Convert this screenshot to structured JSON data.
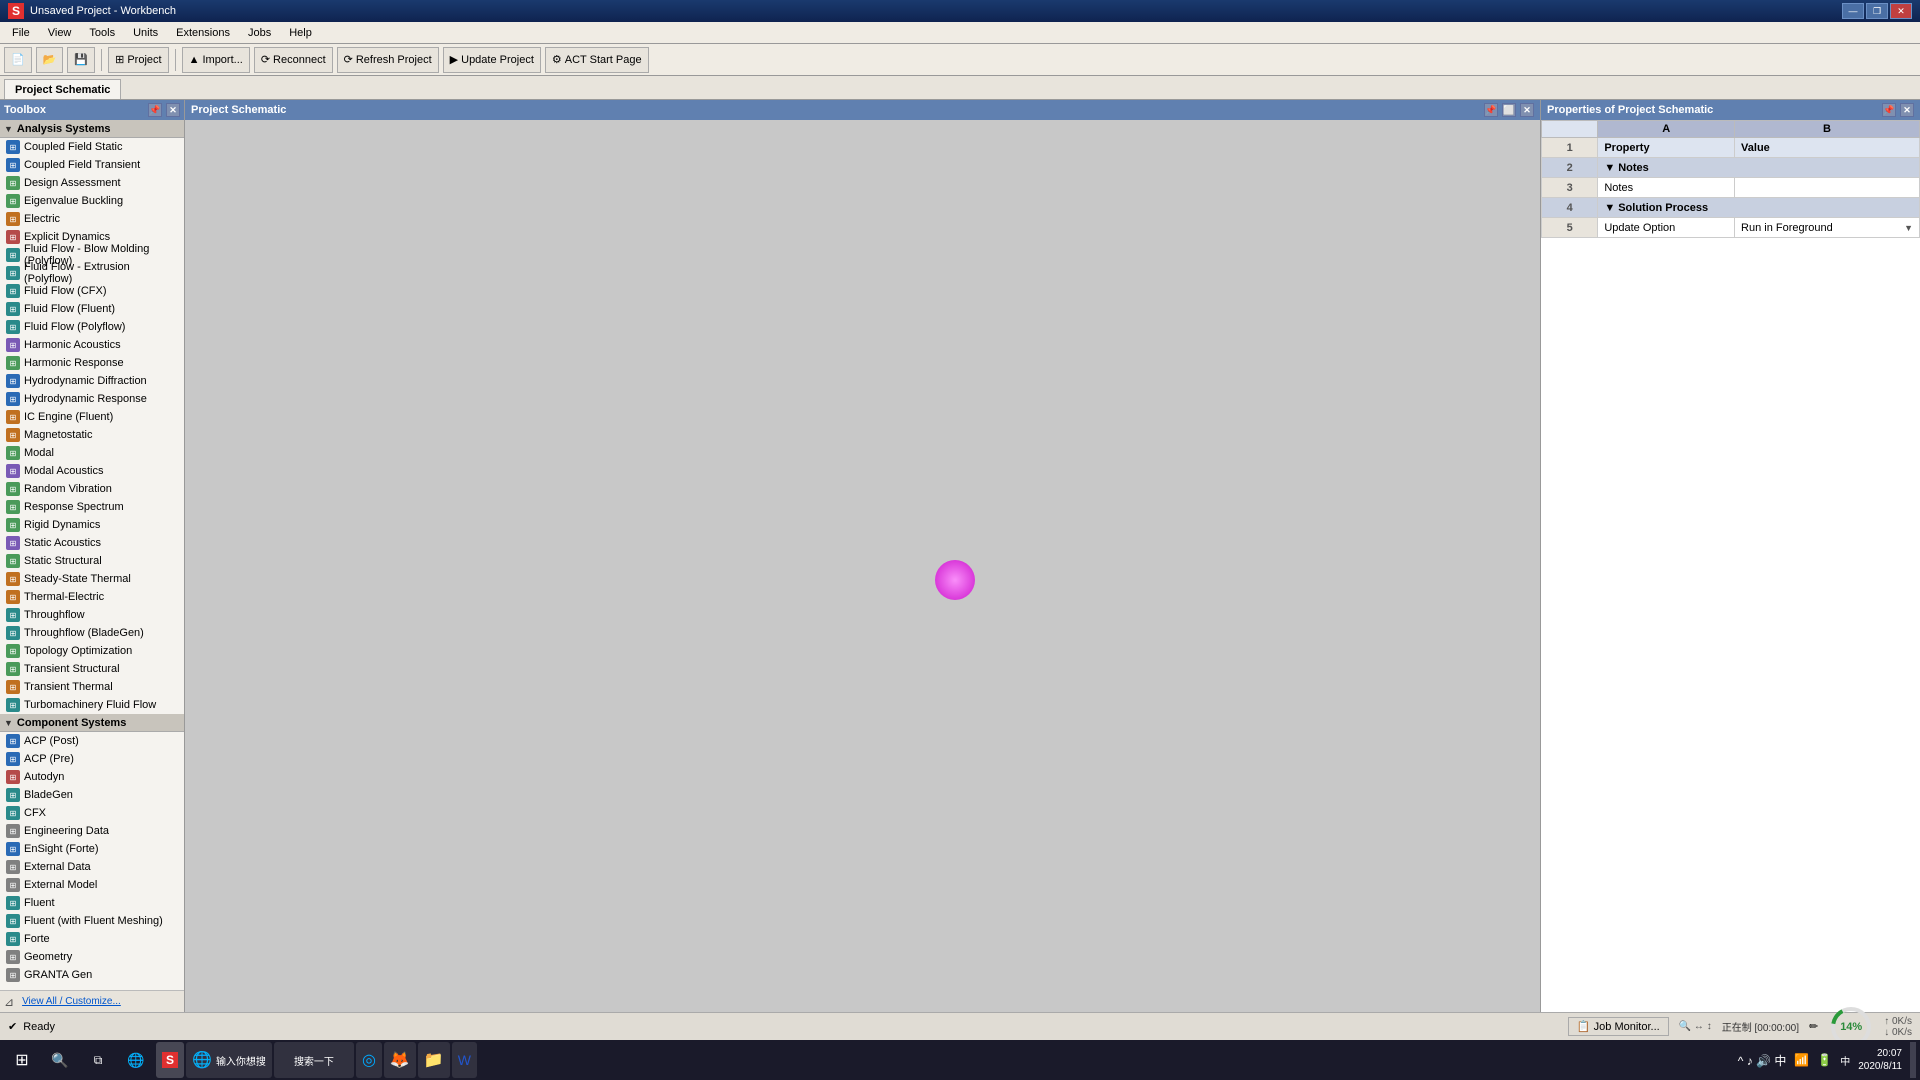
{
  "titleBar": {
    "icon": "S",
    "title": "Unsaved Project - Workbench",
    "windowControls": [
      "—",
      "❐",
      "✕"
    ]
  },
  "menuBar": {
    "items": [
      "File",
      "View",
      "Tools",
      "Units",
      "Extensions",
      "Jobs",
      "Help"
    ]
  },
  "toolbar": {
    "buttons": [
      {
        "id": "new",
        "icon": "📄",
        "label": ""
      },
      {
        "id": "open",
        "icon": "📂",
        "label": ""
      },
      {
        "id": "save",
        "icon": "💾",
        "label": ""
      },
      {
        "id": "import-btn",
        "label": "▲ Import..."
      },
      {
        "id": "reconnect",
        "label": "⟳ Reconnect"
      },
      {
        "id": "refresh",
        "label": "⟳ Refresh Project"
      },
      {
        "id": "update",
        "label": "▶ Update Project"
      },
      {
        "id": "act-start",
        "label": "⚙ ACT Start Page"
      },
      {
        "id": "project-tab",
        "label": "Project"
      }
    ]
  },
  "tabs": [
    {
      "id": "project-schematic",
      "label": "Project Schematic",
      "active": true
    }
  ],
  "toolbox": {
    "title": "Toolbox",
    "analysisSection": {
      "label": "Analysis Systems",
      "items": [
        {
          "id": "coupled-field-static",
          "label": "Coupled Field Static"
        },
        {
          "id": "coupled-field-transient",
          "label": "Coupled Field Transient"
        },
        {
          "id": "design-assessment",
          "label": "Design Assessment"
        },
        {
          "id": "eigenvalue-buckling",
          "label": "Eigenvalue Buckling"
        },
        {
          "id": "electric",
          "label": "Electric"
        },
        {
          "id": "explicit-dynamics",
          "label": "Explicit Dynamics"
        },
        {
          "id": "fluid-blow-molding",
          "label": "Fluid Flow - Blow Molding (Polyflow)"
        },
        {
          "id": "fluid-extrusion",
          "label": "Fluid Flow - Extrusion (Polyflow)"
        },
        {
          "id": "fluid-flow-cfx",
          "label": "Fluid Flow (CFX)"
        },
        {
          "id": "fluid-flow-fluent",
          "label": "Fluid Flow (Fluent)"
        },
        {
          "id": "fluid-flow-polyflow",
          "label": "Fluid Flow (Polyflow)"
        },
        {
          "id": "harmonic-acoustics",
          "label": "Harmonic Acoustics"
        },
        {
          "id": "harmonic-response",
          "label": "Harmonic Response"
        },
        {
          "id": "hydrodynamic-diffraction",
          "label": "Hydrodynamic Diffraction"
        },
        {
          "id": "hydrodynamic-response",
          "label": "Hydrodynamic Response"
        },
        {
          "id": "ic-engine-fluent",
          "label": "IC Engine (Fluent)"
        },
        {
          "id": "magnetostatic",
          "label": "Magnetostatic"
        },
        {
          "id": "modal",
          "label": "Modal"
        },
        {
          "id": "modal-acoustics",
          "label": "Modal Acoustics"
        },
        {
          "id": "random-vibration",
          "label": "Random Vibration"
        },
        {
          "id": "response-spectrum",
          "label": "Response Spectrum"
        },
        {
          "id": "rigid-dynamics",
          "label": "Rigid Dynamics"
        },
        {
          "id": "static-acoustics",
          "label": "Static Acoustics"
        },
        {
          "id": "static-structural",
          "label": "Static Structural"
        },
        {
          "id": "steady-state-thermal",
          "label": "Steady-State Thermal"
        },
        {
          "id": "thermal-electric",
          "label": "Thermal-Electric"
        },
        {
          "id": "throughflow",
          "label": "Throughflow"
        },
        {
          "id": "throughflow-bladegen",
          "label": "Throughflow (BladeGen)"
        },
        {
          "id": "topology-optimization",
          "label": "Topology Optimization"
        },
        {
          "id": "transient-structural",
          "label": "Transient Structural"
        },
        {
          "id": "transient-thermal",
          "label": "Transient Thermal"
        },
        {
          "id": "turbomachinery-fluid-flow",
          "label": "Turbomachinery Fluid Flow"
        }
      ]
    },
    "componentSection": {
      "label": "Component Systems",
      "items": [
        {
          "id": "acp-post",
          "label": "ACP (Post)"
        },
        {
          "id": "acp-pre",
          "label": "ACP (Pre)"
        },
        {
          "id": "autodyn",
          "label": "Autodyn"
        },
        {
          "id": "bladegen",
          "label": "BladeGen"
        },
        {
          "id": "cfx",
          "label": "CFX"
        },
        {
          "id": "engineering-data",
          "label": "Engineering Data"
        },
        {
          "id": "ensight-forte",
          "label": "EnSight (Forte)"
        },
        {
          "id": "external-data",
          "label": "External Data"
        },
        {
          "id": "external-model",
          "label": "External Model"
        },
        {
          "id": "fluent",
          "label": "Fluent"
        },
        {
          "id": "fluent-meshing",
          "label": "Fluent (with Fluent Meshing)"
        },
        {
          "id": "forte",
          "label": "Forte"
        },
        {
          "id": "geometry",
          "label": "Geometry"
        },
        {
          "id": "granta-gen",
          "label": "GRANTA Gen"
        }
      ]
    },
    "viewAll": "View All / Customize..."
  },
  "properties": {
    "title": "Properties of Project Schematic",
    "columns": {
      "a": "A",
      "b": "B"
    },
    "columnHeaders": {
      "property": "Property",
      "value": "Value"
    },
    "rows": [
      {
        "num": "1",
        "label": "Property",
        "value": "Value",
        "isHeader": true
      },
      {
        "num": "2",
        "label": "Notes",
        "value": "",
        "isSection": true
      },
      {
        "num": "3",
        "label": "Notes",
        "value": ""
      },
      {
        "num": "4",
        "label": "Solution Process",
        "value": "",
        "isSection": true
      },
      {
        "num": "5",
        "label": "Update Option",
        "value": "Run in Foreground"
      }
    ]
  },
  "statusBar": {
    "statusText": "Ready",
    "jobMonitor": "Job Monitor...",
    "progressPercent": "14%",
    "time": "00:00:00",
    "networkStats": {
      "up": "0K/s",
      "down": "0K/s"
    },
    "timeDisplay": "20:07",
    "dateDisplay": "2020/8/11",
    "statusFlags": [
      "正在制 [00:00:00]"
    ]
  }
}
